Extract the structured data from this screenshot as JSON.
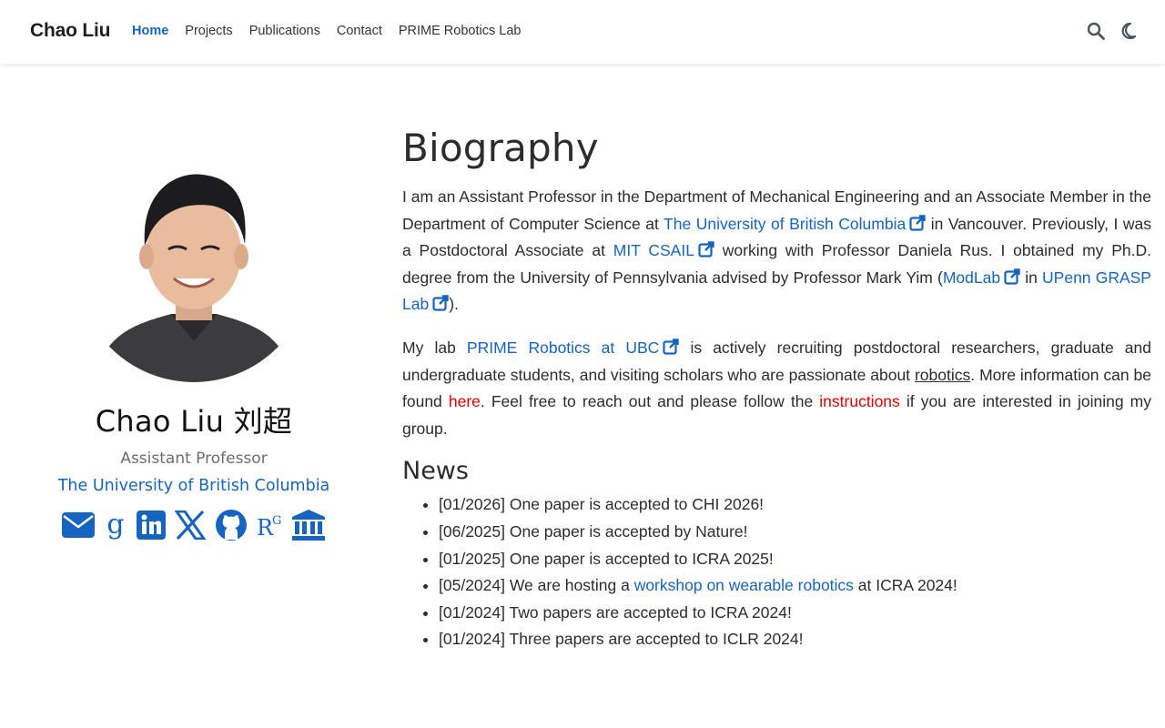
{
  "navbar": {
    "brand": "Chao Liu",
    "links": [
      {
        "label": "Home",
        "active": true
      },
      {
        "label": "Projects",
        "active": false
      },
      {
        "label": "Publications",
        "active": false
      },
      {
        "label": "Contact",
        "active": false
      },
      {
        "label": "PRIME Robotics Lab",
        "active": false
      }
    ],
    "icons": [
      "search-icon",
      "dark-mode-icon"
    ]
  },
  "profile": {
    "name": "Chao Liu 刘超",
    "role": "Assistant Professor",
    "organization": "The University of British Columbia",
    "social_icons": [
      "email-icon",
      "google-scholar-icon",
      "linkedin-icon",
      "x-twitter-icon",
      "github-icon",
      "researchgate-icon",
      "institution-icon"
    ]
  },
  "biography": {
    "heading": "Biography",
    "p1": {
      "t1": "I am an Assistant Professor in the Department of Mechanical Engineering and an Associate Member in the Department of Computer Science at ",
      "link1": "The University of British Columbia",
      "t2": " in Vancouver. Previously, I was a Postdoctoral Associate at ",
      "link2": "MIT CSAIL",
      "t3": " working with Professor Daniela Rus. I obtained my Ph.D. degree from the University of Pennsylvania advised by Professor Mark Yim (",
      "link3": "ModLab",
      "t4": " in ",
      "link4": "UPenn GRASP Lab",
      "t5": ")."
    },
    "p2": {
      "t1": "My lab ",
      "link1": "PRIME Robotics at UBC",
      "t2": " is actively recruiting postdoctoral researchers, graduate and undergraduate students, and visiting scholars who are passionate about ",
      "underline": "robotics",
      "t3": ". More information can be found ",
      "link2": "here",
      "t4": ". Feel free to reach out and please follow the ",
      "link3": "instructions",
      "t5": " if you are interested in joining my group."
    }
  },
  "news": {
    "heading": "News",
    "items": [
      {
        "text": "[01/2026] One paper is accepted to CHI 2026!"
      },
      {
        "text": "[06/2025] One paper is accepted by Nature!"
      },
      {
        "text": "[01/2025] One paper is accepted to ICRA 2025!"
      },
      {
        "pre": "[05/2024] We are hosting a ",
        "link": "workshop on wearable robotics",
        "post": " at ICRA 2024!"
      },
      {
        "text": "[01/2024] Two papers are accepted to ICRA 2024!"
      },
      {
        "text": "[01/2024] Three papers are accepted to ICLR 2024!"
      }
    ]
  },
  "colors": {
    "link": "#1565c0",
    "accent_red": "#e60000",
    "text": "#2c2c2c",
    "muted": "#6d6d6d"
  }
}
